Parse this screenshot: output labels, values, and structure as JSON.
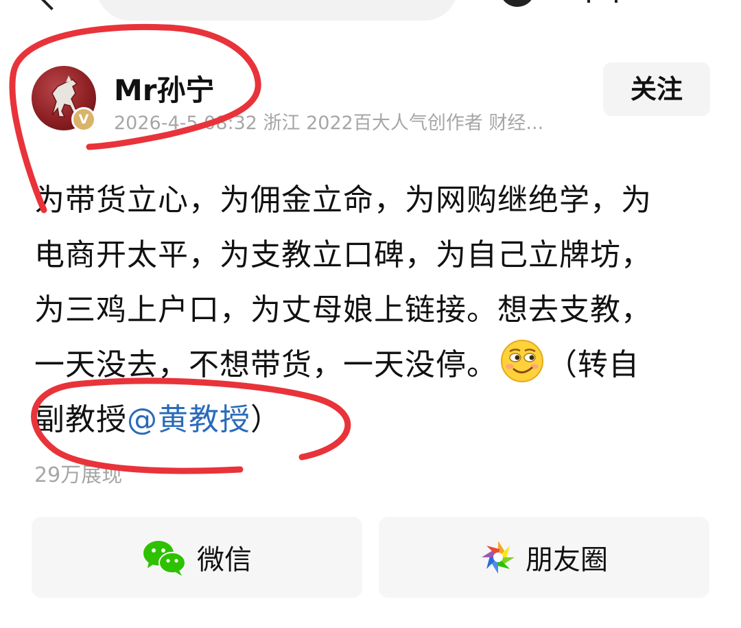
{
  "post": {
    "author": "Mr孙宁",
    "badge": "V",
    "meta": "2026-4-5 08:32 浙江 2022百大人气创作者 财经...",
    "follow_label": "关注",
    "content": {
      "line1": "为带货立心，为佣金立命，为网购继绝学，为",
      "line2": "电商开太平，为支教立口碑，为自己立牌坊，",
      "line3": "为三鸡上户口，为丈母娘上链接。想去支教，",
      "line4_text": "一天没去，不想带货，一天没停。",
      "line4_after": "（转自",
      "line5_text": "副教授",
      "line5_mention": "@黄教授",
      "line5_after": "）"
    },
    "views": "29万展现"
  },
  "share": {
    "wechat_label": "微信",
    "moments_label": "朋友圈"
  },
  "colors": {
    "mention": "#2a6bb9",
    "annotation": "#e8333a",
    "wechat_green": "#2dc100"
  }
}
